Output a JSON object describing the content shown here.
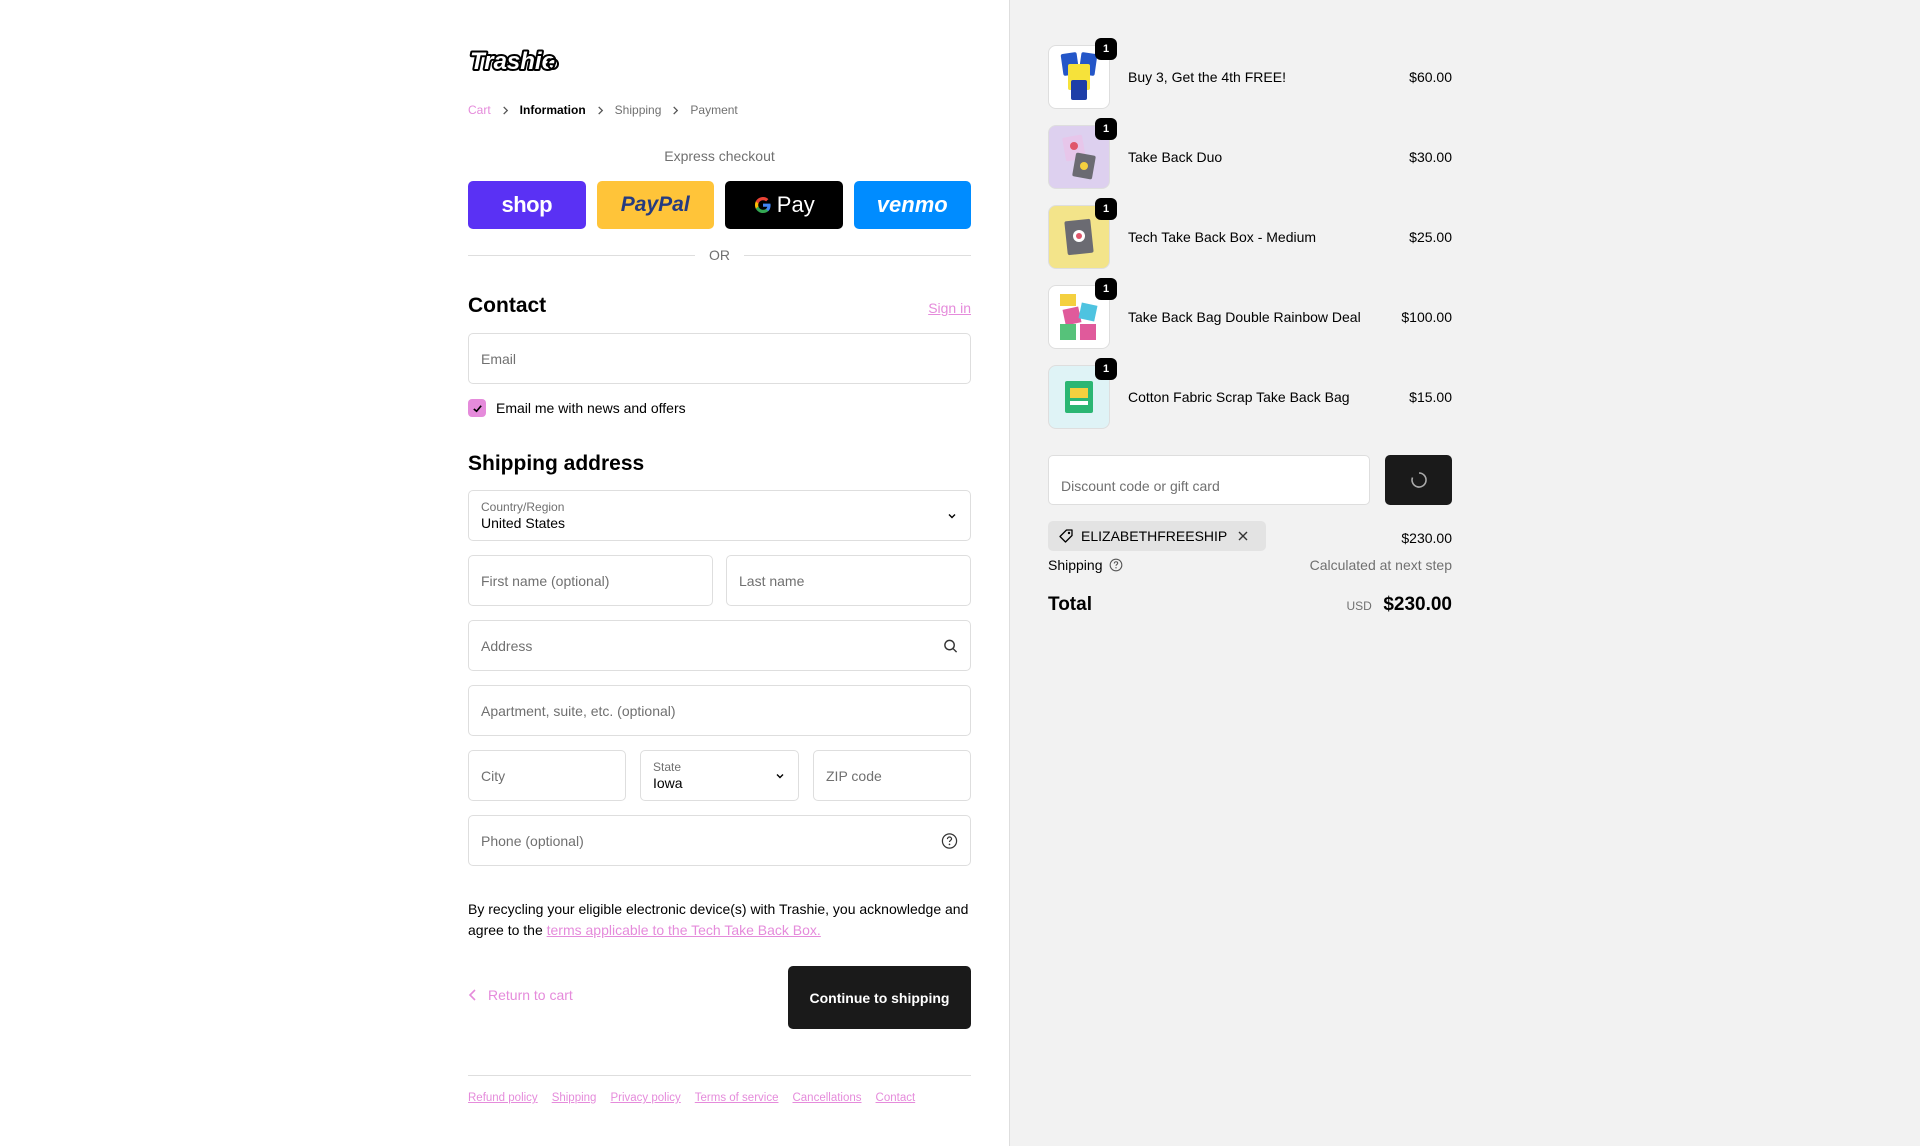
{
  "brand": {
    "name": "Trashie",
    "accent": "#e58bdb"
  },
  "breadcrumb": {
    "cart": "Cart",
    "information": "Information",
    "shipping": "Shipping",
    "payment": "Payment"
  },
  "express": {
    "title": "Express checkout",
    "shop_label": "shop",
    "paypal_label": "PayPal",
    "gpay_label": "Pay",
    "venmo_label": "venmo",
    "or_label": "OR"
  },
  "contact": {
    "title": "Contact",
    "sign_in": "Sign in",
    "email_placeholder": "Email",
    "newsletter_label": "Email me with news and offers",
    "newsletter_checked": true
  },
  "shipping_address": {
    "title": "Shipping address",
    "country_label": "Country/Region",
    "country_value": "United States",
    "first_name_placeholder": "First name (optional)",
    "last_name_placeholder": "Last name",
    "address_placeholder": "Address",
    "apartment_placeholder": "Apartment, suite, etc. (optional)",
    "city_placeholder": "City",
    "state_label": "State",
    "state_value": "Iowa",
    "zip_placeholder": "ZIP code",
    "phone_placeholder": "Phone (optional)"
  },
  "notice": {
    "text": "By recycling your eligible electronic device(s) with Trashie, you acknowledge and agree to the ",
    "link": "terms applicable to the Tech Take Back Box."
  },
  "actions": {
    "return_label": "Return to cart",
    "continue_label": "Continue to shipping"
  },
  "footer": {
    "links": [
      "Refund policy",
      "Shipping",
      "Privacy policy",
      "Terms of service",
      "Cancellations",
      "Contact"
    ]
  },
  "order": {
    "items": [
      {
        "name": "Buy 3, Get the 4th FREE!",
        "price": "$60.00",
        "qty": "1"
      },
      {
        "name": "Take Back Duo",
        "price": "$30.00",
        "qty": "1"
      },
      {
        "name": "Tech Take Back Box - Medium",
        "price": "$25.00",
        "qty": "1"
      },
      {
        "name": "Take Back Bag Double Rainbow Deal",
        "price": "$100.00",
        "qty": "1"
      },
      {
        "name": "Cotton Fabric Scrap Take Back Bag",
        "price": "$15.00",
        "qty": "1"
      }
    ],
    "discount_placeholder": "Discount code or gift card",
    "applied_code": "ELIZABETHFREESHIP",
    "subtotal": "$230.00",
    "shipping_label": "Shipping",
    "shipping_value": "Calculated at next step",
    "total_label": "Total",
    "currency": "USD",
    "total": "$230.00"
  }
}
